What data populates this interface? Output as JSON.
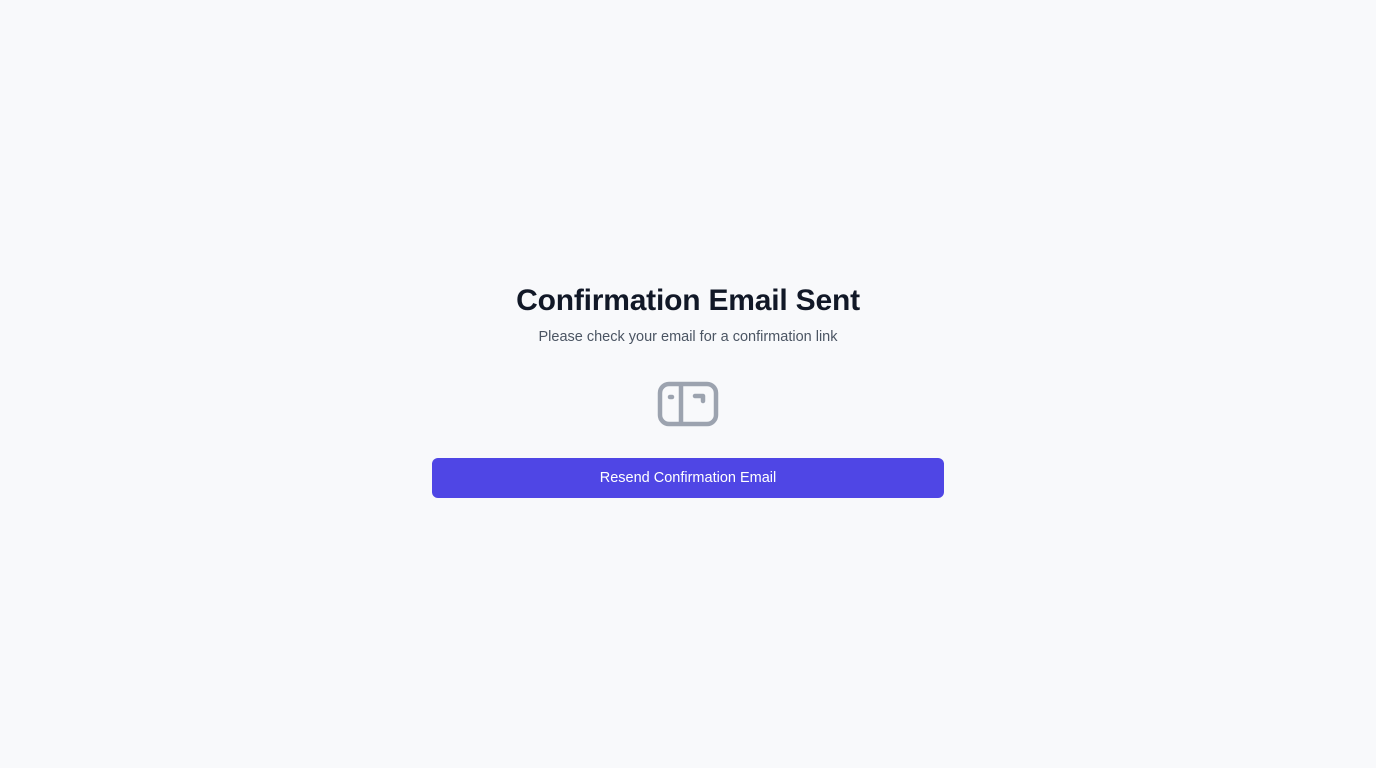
{
  "confirmation": {
    "title": "Confirmation Email Sent",
    "subtitle": "Please check your email for a confirmation link",
    "icon": "mailbox-icon",
    "icon_color": "#9ca3af",
    "resend_button_label": "Resend Confirmation Email",
    "accent_color": "#4f46e5"
  }
}
